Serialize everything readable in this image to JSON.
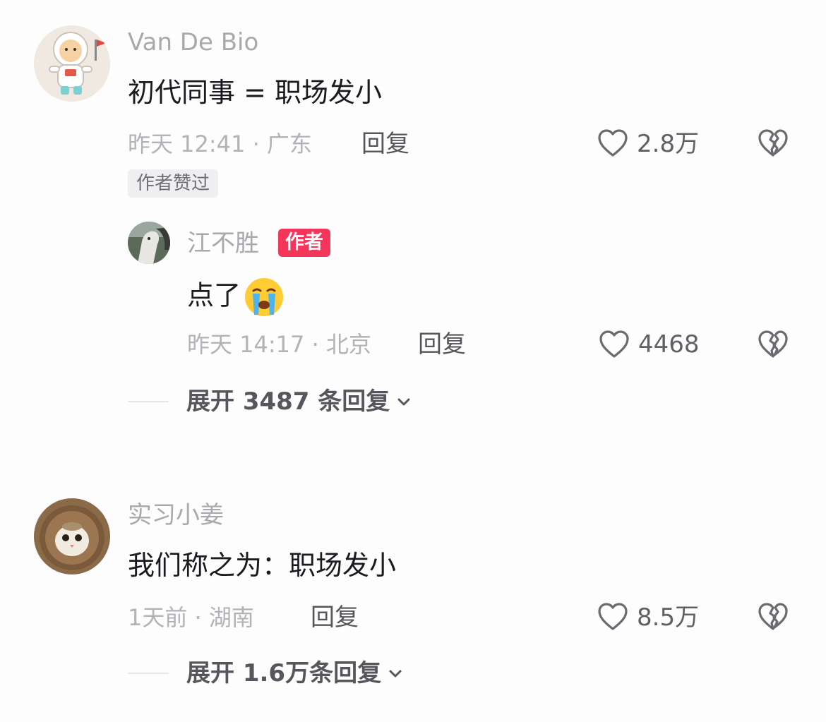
{
  "comments": [
    {
      "username": "Van De Bio",
      "text": "初代同事 = 职场发小",
      "time_location": "昨天 12:41 · 广东",
      "reply_label": "回复",
      "like_count": "2.8万",
      "author_liked_badge": "作者赞过",
      "avatar": "cat-astronaut-avatar",
      "replies": [
        {
          "username": "江不胜",
          "author_badge": "作者",
          "text": "点了",
          "emoji": "loudly-crying-face",
          "time_location": "昨天 14:17 · 北京",
          "reply_label": "回复",
          "like_count": "4468",
          "avatar": "horse-photo-avatar"
        }
      ],
      "expand_label": "展开 3487 条回复"
    },
    {
      "username": "实习小姜",
      "text": "我们称之为：职场发小",
      "time_location": "1天前 · 湖南",
      "reply_label": "回复",
      "like_count": "8.5万",
      "avatar": "lion-cat-avatar",
      "expand_label": "展开 1.6万条回复"
    }
  ],
  "icons": {
    "like": "heart-outline-icon",
    "dislike": "broken-heart-icon",
    "expand": "chevron-down-icon"
  },
  "colors": {
    "author_badge": "#f33659",
    "background": "#fdfdfd"
  }
}
